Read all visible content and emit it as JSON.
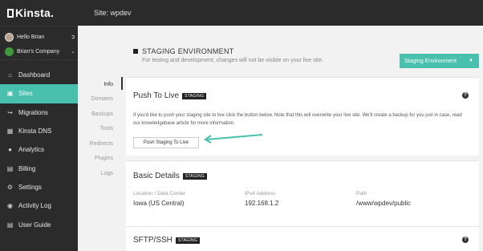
{
  "app": {
    "logo_text": "Kinsta.",
    "site_title": "Site: wpdev"
  },
  "user": {
    "greeting": "Hello Brian",
    "company": "Brian's Company"
  },
  "sidebar": {
    "items": [
      {
        "label": "Dashboard",
        "icon": "home-icon",
        "active": false
      },
      {
        "label": "Sites",
        "icon": "sites-icon",
        "active": true
      },
      {
        "label": "Migrations",
        "icon": "migrations-icon",
        "active": false
      },
      {
        "label": "Kinsta DNS",
        "icon": "dns-icon",
        "active": false
      },
      {
        "label": "Analytics",
        "icon": "analytics-icon",
        "active": false
      },
      {
        "label": "Billing",
        "icon": "billing-icon",
        "active": false
      },
      {
        "label": "Settings",
        "icon": "gear-icon",
        "active": false
      },
      {
        "label": "Activity Log",
        "icon": "activity-icon",
        "active": false
      },
      {
        "label": "User Guide",
        "icon": "guide-icon",
        "active": false
      }
    ]
  },
  "environment": {
    "title": "STAGING ENVIRONMENT",
    "subtitle": "For testing and development, changes will not be visible on your live site.",
    "select_value": "Staging Environment"
  },
  "subnav": {
    "items": [
      {
        "label": "Info",
        "active": true
      },
      {
        "label": "Domains",
        "active": false
      },
      {
        "label": "Backups",
        "active": false
      },
      {
        "label": "Tools",
        "active": false
      },
      {
        "label": "Redirects",
        "active": false
      },
      {
        "label": "Plugins",
        "active": false
      },
      {
        "label": "Logs",
        "active": false
      }
    ]
  },
  "push_card": {
    "title": "Push To Live",
    "badge": "STAGING",
    "description": "If you'd like to push your staging site to live click the button below. Note that this will overwrite your live site. We'll create a backup for you just in case, read our knowledgebase article for more information.",
    "button_label": "Push Staging To Live"
  },
  "details_card": {
    "title": "Basic Details",
    "badge": "STAGING",
    "location_label": "Location / Data Center",
    "location_value": "Iowa (US Central)",
    "ip_label": "IPv4 Address",
    "ip_value": "192.168.1.2",
    "path_label": "Path",
    "path_value": "/www/wpdev/public"
  },
  "sftp_card": {
    "title": "SFTP/SSH",
    "badge": "STAGING"
  },
  "colors": {
    "accent": "#49c0ad",
    "sidebar_bg": "#2b2b2b",
    "arrow": "#49c0ad"
  }
}
